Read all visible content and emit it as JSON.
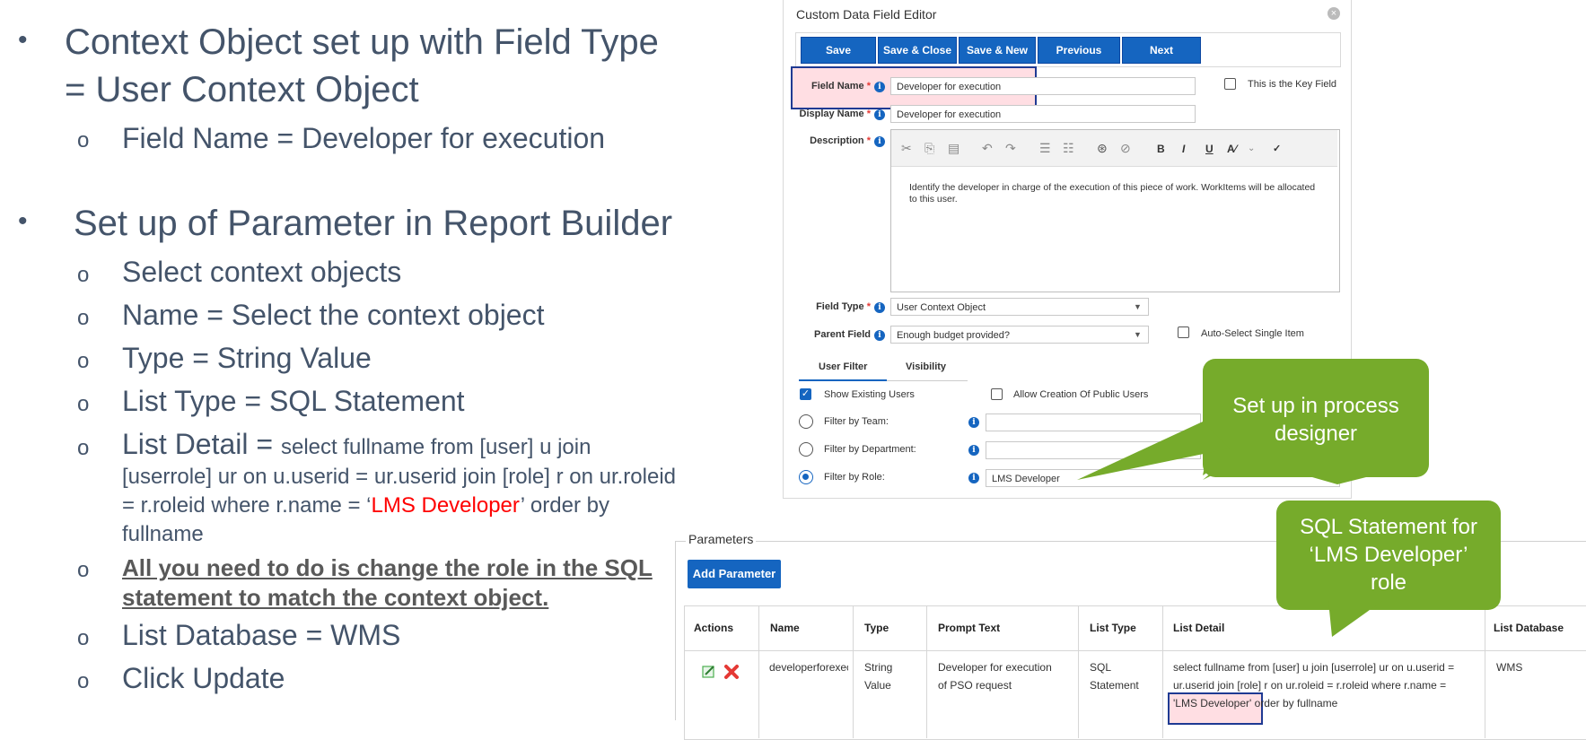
{
  "slide": {
    "bullet1_title_line1": "Context Object set up with Field Type",
    "bullet1_title_line2": "= User Context Object",
    "bullet1_sub": "Field Name = Developer for execution",
    "bullet2_title": "Set up of Parameter in Report Builder",
    "bullet2_items": {
      "select": "Select context objects",
      "name": "Name = Select the context object",
      "type": "Type = String Value",
      "list_type": "List Type = SQL Statement",
      "list_detail_label": "List Detail = ",
      "list_detail_line1": "select fullname from [user] u join",
      "list_detail_line2": "[userrole] ur on u.userid = ur.userid join [role] r on ur.roleid",
      "list_detail_line3a": "= r.roleid where r.name = ‘",
      "list_detail_role": "LMS Developer",
      "list_detail_line3b": "’ order by",
      "list_detail_line4": "fullname",
      "note_line1": "All you need to do is change the role in the SQL",
      "note_line2": "statement to match the context object.",
      "list_database": "List Database = WMS",
      "click_update": "Click Update"
    },
    "bullet_char": "•",
    "sub_bullet_char": "o"
  },
  "editor": {
    "title": "Custom Data Field Editor",
    "close": "×",
    "buttons": {
      "save": "Save",
      "save_close": "Save & Close",
      "save_new": "Save & New",
      "previous": "Previous",
      "next": "Next"
    },
    "fields": {
      "field_name_label": "Field Name",
      "field_name_value": "Developer for execution",
      "key_field_label": "This is the Key Field",
      "display_name_label": "Display Name",
      "display_name_value": "Developer for execution",
      "description_label": "Description",
      "description_text": "Identify the developer in charge of the execution of this piece of work. WorkItems will be allocated to this user.",
      "field_type_label": "Field Type",
      "field_type_value": "User Context Object",
      "parent_field_label": "Parent Field",
      "parent_field_value": "Enough budget provided?",
      "auto_select_label": "Auto-Select Single Item",
      "required_mark": "*",
      "info_mark": "i"
    },
    "rte_format": {
      "bold": "B",
      "italic": "I",
      "underline": "U"
    },
    "tabs": {
      "user_filter": "User Filter",
      "visibility": "Visibility"
    },
    "filters": {
      "show_existing": "Show Existing Users",
      "allow_public": "Allow Creation Of Public Users",
      "by_team": "Filter by Team:",
      "by_department": "Filter by Department:",
      "by_role": "Filter by Role:",
      "role_value": "LMS Developer"
    },
    "colors": {
      "primary_button": "#1565c0",
      "highlight_border": "#1f3a93"
    }
  },
  "parameters": {
    "title": "Parameters",
    "add_button": "Add Parameter",
    "headers": [
      "Actions",
      "Name",
      "Type",
      "Prompt Text",
      "List Type",
      "List Detail",
      "List Database"
    ],
    "row": {
      "name": "developerforexec",
      "type_line1": "String",
      "type_line2": "Value",
      "prompt_line1": "Developer for execution",
      "prompt_line2": "of PSO request",
      "list_type_line1": "SQL",
      "list_type_line2": "Statement",
      "detail_line1": "select fullname from [user] u join [userrole] ur on u.userid =",
      "detail_line2": "ur.userid join [role] r on ur.roleid = r.roleid where r.name =",
      "detail_line3a": "'LMS Developer'",
      "detail_line3b": " order by fullname",
      "database": "WMS"
    }
  },
  "callouts": {
    "process_designer_line1": "Set up in process",
    "process_designer_line2": "designer",
    "sql_line1": "SQL Statement for",
    "sql_line2": "‘LMS Developer’",
    "sql_line3": "role",
    "color": "#76ab2b"
  }
}
